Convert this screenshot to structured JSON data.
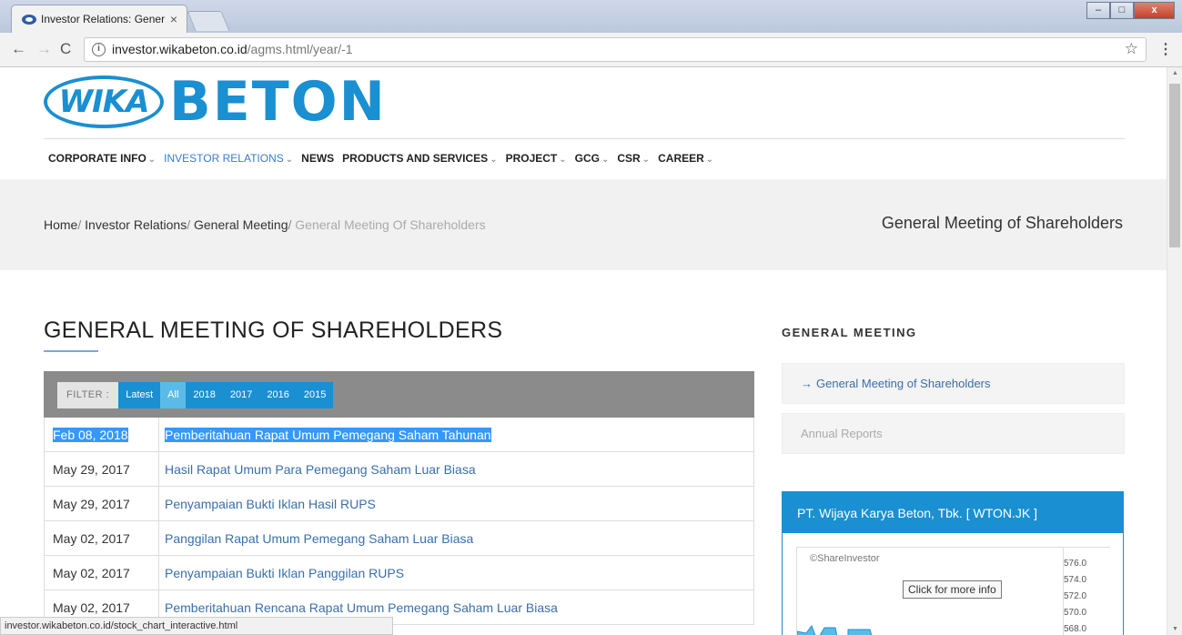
{
  "browser": {
    "tab_title": "Investor Relations: Gener",
    "tab_close": "×",
    "url_host": "investor.wikabeton.co.id",
    "url_path": "/agms.html/year/-1",
    "status_url": "investor.wikabeton.co.id/stock_chart_interactive.html",
    "win_min": "–",
    "win_max": "□",
    "win_close": "x"
  },
  "logo": {
    "wika": "WIKA",
    "beton": "BETON"
  },
  "nav": [
    {
      "label": "CORPORATE INFO",
      "chevron": "⌄"
    },
    {
      "label": "INVESTOR RELATIONS",
      "chevron": "⌄"
    },
    {
      "label": "NEWS",
      "chevron": ""
    },
    {
      "label": "PRODUCTS AND SERVICES",
      "chevron": "⌄"
    },
    {
      "label": "PROJECT",
      "chevron": "⌄"
    },
    {
      "label": "GCG",
      "chevron": "⌄"
    },
    {
      "label": "CSR",
      "chevron": "⌄"
    },
    {
      "label": "CAREER",
      "chevron": "⌄"
    }
  ],
  "breadcrumb": {
    "home": "Home",
    "ir": "Investor Relations",
    "gm": "General Meeting",
    "current": "General Meeting Of Shareholders",
    "sep": "/"
  },
  "band_title": "General Meeting of Shareholders",
  "main": {
    "heading": "GENERAL MEETING OF SHAREHOLDERS",
    "filter_label": "FILTER :",
    "filters": [
      "Latest",
      "All",
      "2018",
      "2017",
      "2016",
      "2015"
    ],
    "selected_filter": "All",
    "rows": [
      {
        "date": "Feb 08, 2018",
        "title": "Pemberitahuan Rapat Umum Pemegang Saham Tahunan"
      },
      {
        "date": "May 29, 2017",
        "title": "Hasil Rapat Umum Para Pemegang Saham Luar Biasa"
      },
      {
        "date": "May 29, 2017",
        "title": "Penyampaian Bukti Iklan Hasil RUPS"
      },
      {
        "date": "May 02, 2017",
        "title": "Panggilan Rapat Umum Pemegang Saham Luar Biasa"
      },
      {
        "date": "May 02, 2017",
        "title": "Penyampaian Bukti Iklan Panggilan RUPS"
      },
      {
        "date": "May 02, 2017",
        "title": "Pemberitahuan Rencana Rapat Umum Pemegang Saham Luar Biasa"
      }
    ]
  },
  "sidebar": {
    "heading": "GENERAL MEETING",
    "item_active": "General Meeting of Shareholders",
    "item_active_arrow": "→",
    "item_other": "Annual Reports"
  },
  "stock": {
    "title": "PT. Wijaya Karya Beton, Tbk. [ WTON.JK ]",
    "copyright": "©ShareInvestor",
    "tooltip": "Click for more info",
    "ticks": [
      "576.0",
      "574.0",
      "572.0",
      "570.0",
      "568.0"
    ]
  }
}
